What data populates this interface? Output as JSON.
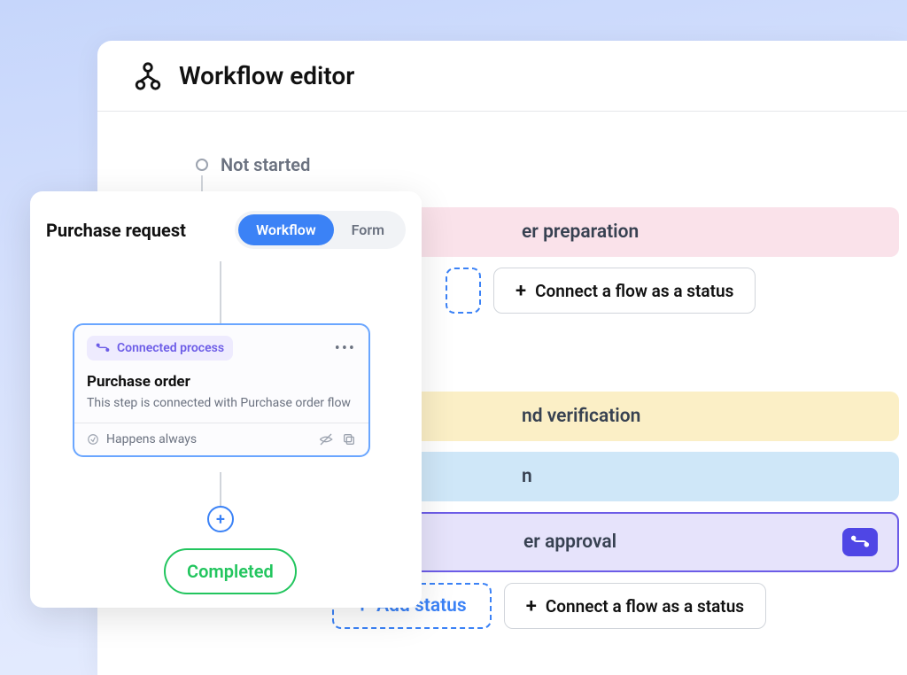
{
  "main": {
    "title": "Workflow editor",
    "not_started": "Not started",
    "bars": {
      "preparation": "er preparation",
      "verification": "nd verification",
      "n": "n",
      "approval": "er approval"
    },
    "connect_flow": "Connect a flow as a status",
    "add_status": "Add status"
  },
  "panel": {
    "title": "Purchase request",
    "tab_workflow": "Workflow",
    "tab_form": "Form",
    "step": {
      "badge": "Connected process",
      "name": "Purchase order",
      "desc": "This step is connected with Purchase order flow",
      "happens": "Happens always"
    },
    "completed": "Completed"
  }
}
